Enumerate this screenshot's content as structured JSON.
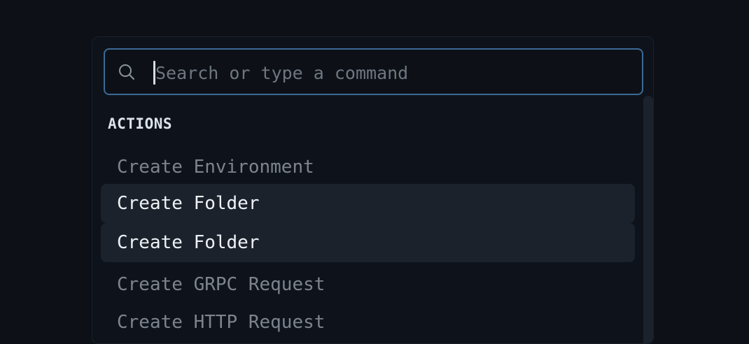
{
  "search": {
    "placeholder": "Search or type a command",
    "value": ""
  },
  "section": {
    "label": "ACTIONS"
  },
  "items": [
    {
      "label": "Create Environment"
    },
    {
      "label": "Create Folder"
    },
    {
      "label": "Create Folder"
    },
    {
      "label": "Create GRPC Request"
    },
    {
      "label": "Create HTTP Request"
    }
  ],
  "icons": {
    "search": "search-icon"
  },
  "colors": {
    "background": "#0d1117",
    "accent_border": "#3c6a96",
    "highlight": "#1c222b"
  }
}
